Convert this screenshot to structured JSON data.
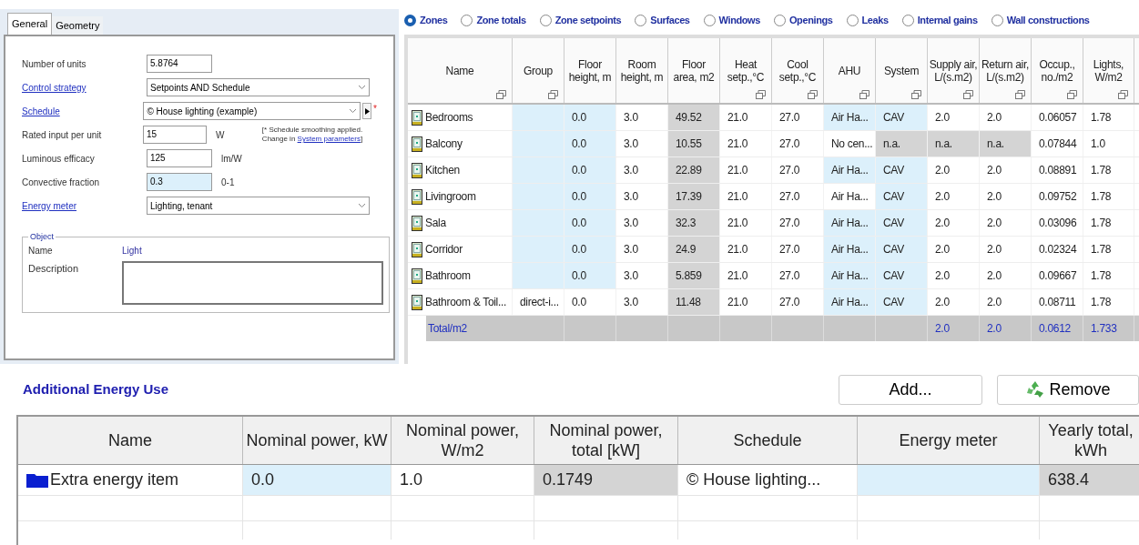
{
  "properties": {
    "tabs": [
      {
        "label": "General",
        "selected": true
      },
      {
        "label": "Geometry",
        "selected": false
      }
    ],
    "fields": [
      {
        "kind": "input",
        "label": "Number of units",
        "link": false,
        "value": "5.8764",
        "focused": false
      },
      {
        "kind": "select",
        "label": "Control strategy",
        "link": true,
        "value": "Setpoints AND Schedule"
      },
      {
        "kind": "select_button",
        "label": "Schedule",
        "link": true,
        "value": "© House lighting (example)",
        "marker": "*"
      },
      {
        "kind": "input",
        "label": "Rated input per unit",
        "link": false,
        "value": "15",
        "unit": "W",
        "focused": false
      },
      {
        "kind": "input",
        "label": "Luminous efficacy",
        "link": false,
        "value": "125",
        "unit": "lm/W",
        "focused": false
      },
      {
        "kind": "input",
        "label": "Convective fraction",
        "link": false,
        "value": "0.3",
        "unit": "0-1",
        "focused": true
      },
      {
        "kind": "select",
        "label": "Energy meter",
        "link": true,
        "value": "Lighting, tenant"
      }
    ],
    "note": {
      "text": "[* Schedule smoothing applied. Change in",
      "link": "System parameters",
      "end": "]"
    },
    "object": {
      "title": "Object",
      "name_label": "Name",
      "name": "Light",
      "description_label": "Description"
    }
  },
  "views": [
    {
      "label": "Zones",
      "selected": true
    },
    {
      "label": "Zone totals",
      "selected": false
    },
    {
      "label": "Zone setpoints",
      "selected": false
    },
    {
      "label": "Surfaces",
      "selected": false
    },
    {
      "label": "Windows",
      "selected": false
    },
    {
      "label": "Openings",
      "selected": false
    },
    {
      "label": "Leaks",
      "selected": false
    },
    {
      "label": "Internal gains",
      "selected": false
    },
    {
      "label": "Wall constructions",
      "selected": false
    }
  ],
  "zones": {
    "columns": [
      {
        "label": "Name",
        "filter": true
      },
      {
        "label": "Group",
        "filter": true
      },
      {
        "label": "Floor height, m",
        "filter": false
      },
      {
        "label": "Room height, m",
        "filter": false
      },
      {
        "label": "Floor area, m2",
        "filter": false
      },
      {
        "label": "Heat setp.,°C",
        "filter": true
      },
      {
        "label": "Cool setp.,°C",
        "filter": true
      },
      {
        "label": "AHU",
        "filter": true
      },
      {
        "label": "System",
        "filter": true
      },
      {
        "label": "Supply air, L/(s.m2)",
        "filter": true
      },
      {
        "label": "Return air, L/(s.m2)",
        "filter": true
      },
      {
        "label": "Occup., no./m2",
        "filter": true
      },
      {
        "label": "Lights, W/m2",
        "filter": true
      }
    ],
    "rows": [
      {
        "cells": [
          {
            "text": "Bedrooms",
            "kind": "plain"
          },
          {
            "kind": "input"
          },
          {
            "text": "0.0",
            "kind": "input"
          },
          {
            "text": "3.0",
            "kind": "plain"
          },
          {
            "text": "49.52",
            "kind": "computed"
          },
          {
            "text": "21.0",
            "kind": "plain"
          },
          {
            "text": "27.0",
            "kind": "plain"
          },
          {
            "text": "Air Ha...",
            "kind": "input"
          },
          {
            "text": "CAV",
            "kind": "input"
          },
          {
            "text": "2.0",
            "kind": "plain"
          },
          {
            "text": "2.0",
            "kind": "plain"
          },
          {
            "text": "0.06057",
            "kind": "plain"
          },
          {
            "text": "1.78",
            "kind": "plain"
          }
        ]
      },
      {
        "cells": [
          {
            "text": "Balcony",
            "kind": "plain"
          },
          {
            "kind": "input"
          },
          {
            "text": "0.0",
            "kind": "input"
          },
          {
            "text": "3.0",
            "kind": "plain"
          },
          {
            "text": "10.55",
            "kind": "computed"
          },
          {
            "text": "21.0",
            "kind": "plain"
          },
          {
            "text": "27.0",
            "kind": "plain"
          },
          {
            "text": "No cen...",
            "kind": "plain"
          },
          {
            "text": "n.a.",
            "kind": "computed"
          },
          {
            "text": "n.a.",
            "kind": "computed"
          },
          {
            "text": "n.a.",
            "kind": "computed"
          },
          {
            "text": "0.07844",
            "kind": "plain"
          },
          {
            "text": "1.0",
            "kind": "plain"
          }
        ]
      },
      {
        "cells": [
          {
            "text": "Kitchen",
            "kind": "plain"
          },
          {
            "kind": "input"
          },
          {
            "text": "0.0",
            "kind": "input"
          },
          {
            "text": "3.0",
            "kind": "plain"
          },
          {
            "text": "22.89",
            "kind": "computed"
          },
          {
            "text": "21.0",
            "kind": "plain"
          },
          {
            "text": "27.0",
            "kind": "plain"
          },
          {
            "text": "Air Ha...",
            "kind": "input"
          },
          {
            "text": "CAV",
            "kind": "input"
          },
          {
            "text": "2.0",
            "kind": "plain"
          },
          {
            "text": "2.0",
            "kind": "plain"
          },
          {
            "text": "0.08891",
            "kind": "plain"
          },
          {
            "text": "1.78",
            "kind": "plain"
          }
        ]
      },
      {
        "cells": [
          {
            "text": "Livingroom",
            "kind": "plain"
          },
          {
            "kind": "input"
          },
          {
            "text": "0.0",
            "kind": "input"
          },
          {
            "text": "3.0",
            "kind": "plain"
          },
          {
            "text": "17.39",
            "kind": "computed"
          },
          {
            "text": "21.0",
            "kind": "plain"
          },
          {
            "text": "27.0",
            "kind": "plain"
          },
          {
            "text": "Air Ha...",
            "kind": "plain"
          },
          {
            "text": "CAV",
            "kind": "input"
          },
          {
            "text": "2.0",
            "kind": "plain"
          },
          {
            "text": "2.0",
            "kind": "plain"
          },
          {
            "text": "0.09752",
            "kind": "plain"
          },
          {
            "text": "1.78",
            "kind": "plain"
          }
        ]
      },
      {
        "cells": [
          {
            "text": "Sala",
            "kind": "plain"
          },
          {
            "kind": "input"
          },
          {
            "text": "0.0",
            "kind": "input"
          },
          {
            "text": "3.0",
            "kind": "plain"
          },
          {
            "text": "32.3",
            "kind": "computed"
          },
          {
            "text": "21.0",
            "kind": "plain"
          },
          {
            "text": "27.0",
            "kind": "plain"
          },
          {
            "text": "Air Ha...",
            "kind": "input"
          },
          {
            "text": "CAV",
            "kind": "input"
          },
          {
            "text": "2.0",
            "kind": "plain"
          },
          {
            "text": "2.0",
            "kind": "plain"
          },
          {
            "text": "0.03096",
            "kind": "plain"
          },
          {
            "text": "1.78",
            "kind": "plain"
          }
        ]
      },
      {
        "cells": [
          {
            "text": "Corridor",
            "kind": "plain"
          },
          {
            "kind": "input"
          },
          {
            "text": "0.0",
            "kind": "input"
          },
          {
            "text": "3.0",
            "kind": "plain"
          },
          {
            "text": "24.9",
            "kind": "computed"
          },
          {
            "text": "21.0",
            "kind": "plain"
          },
          {
            "text": "27.0",
            "kind": "plain"
          },
          {
            "text": "Air Ha...",
            "kind": "input"
          },
          {
            "text": "CAV",
            "kind": "input"
          },
          {
            "text": "2.0",
            "kind": "plain"
          },
          {
            "text": "2.0",
            "kind": "plain"
          },
          {
            "text": "0.02324",
            "kind": "plain"
          },
          {
            "text": "1.78",
            "kind": "plain"
          }
        ]
      },
      {
        "cells": [
          {
            "text": "Bathroom",
            "kind": "plain"
          },
          {
            "kind": "input"
          },
          {
            "text": "0.0",
            "kind": "input"
          },
          {
            "text": "3.0",
            "kind": "plain"
          },
          {
            "text": "5.859",
            "kind": "computed"
          },
          {
            "text": "21.0",
            "kind": "plain"
          },
          {
            "text": "27.0",
            "kind": "plain"
          },
          {
            "text": "Air Ha...",
            "kind": "input"
          },
          {
            "text": "CAV",
            "kind": "input"
          },
          {
            "text": "2.0",
            "kind": "plain"
          },
          {
            "text": "2.0",
            "kind": "plain"
          },
          {
            "text": "0.09667",
            "kind": "plain"
          },
          {
            "text": "1.78",
            "kind": "plain"
          }
        ]
      },
      {
        "cells": [
          {
            "text": "Bathroom & Toil...",
            "kind": "plain"
          },
          {
            "text": "direct-i...",
            "kind": "plain"
          },
          {
            "text": "0.0",
            "kind": "plain"
          },
          {
            "text": "3.0",
            "kind": "plain"
          },
          {
            "text": "11.48",
            "kind": "computed"
          },
          {
            "text": "21.0",
            "kind": "plain"
          },
          {
            "text": "27.0",
            "kind": "plain"
          },
          {
            "text": "Air Ha...",
            "kind": "input"
          },
          {
            "text": "CAV",
            "kind": "input"
          },
          {
            "text": "2.0",
            "kind": "plain"
          },
          {
            "text": "2.0",
            "kind": "plain"
          },
          {
            "text": "0.08711",
            "kind": "plain"
          },
          {
            "text": "1.78",
            "kind": "plain"
          }
        ]
      }
    ],
    "total": {
      "label": "Total/m2",
      "cells": [
        {},
        {},
        {},
        {},
        {},
        {},
        {},
        {},
        {
          "text": "2.0"
        },
        {
          "text": "2.0"
        },
        {
          "text": "0.0612"
        },
        {
          "text": "1.733"
        }
      ]
    }
  },
  "additional": {
    "title": "Additional Energy Use",
    "buttons": [
      {
        "kind": "add",
        "label": "Add..."
      },
      {
        "kind": "remove",
        "label": "Remove"
      }
    ],
    "columns": [
      "Name",
      "Nominal power, kW",
      "Nominal power, W/m2",
      "Nominal power, total [kW]",
      "Schedule",
      "Energy meter",
      "Yearly total, kWh"
    ],
    "rows": [
      {
        "cells": [
          {
            "text": "Extra energy item",
            "kind": "plain"
          },
          {
            "text": "0.0",
            "kind": "input"
          },
          {
            "text": "1.0",
            "kind": "plain"
          },
          {
            "text": "0.1749",
            "kind": "computed"
          },
          {
            "text": "© House lighting...",
            "kind": "plain"
          },
          {
            "kind": "input"
          },
          {
            "text": "638.4",
            "kind": "computed"
          }
        ]
      }
    ]
  }
}
